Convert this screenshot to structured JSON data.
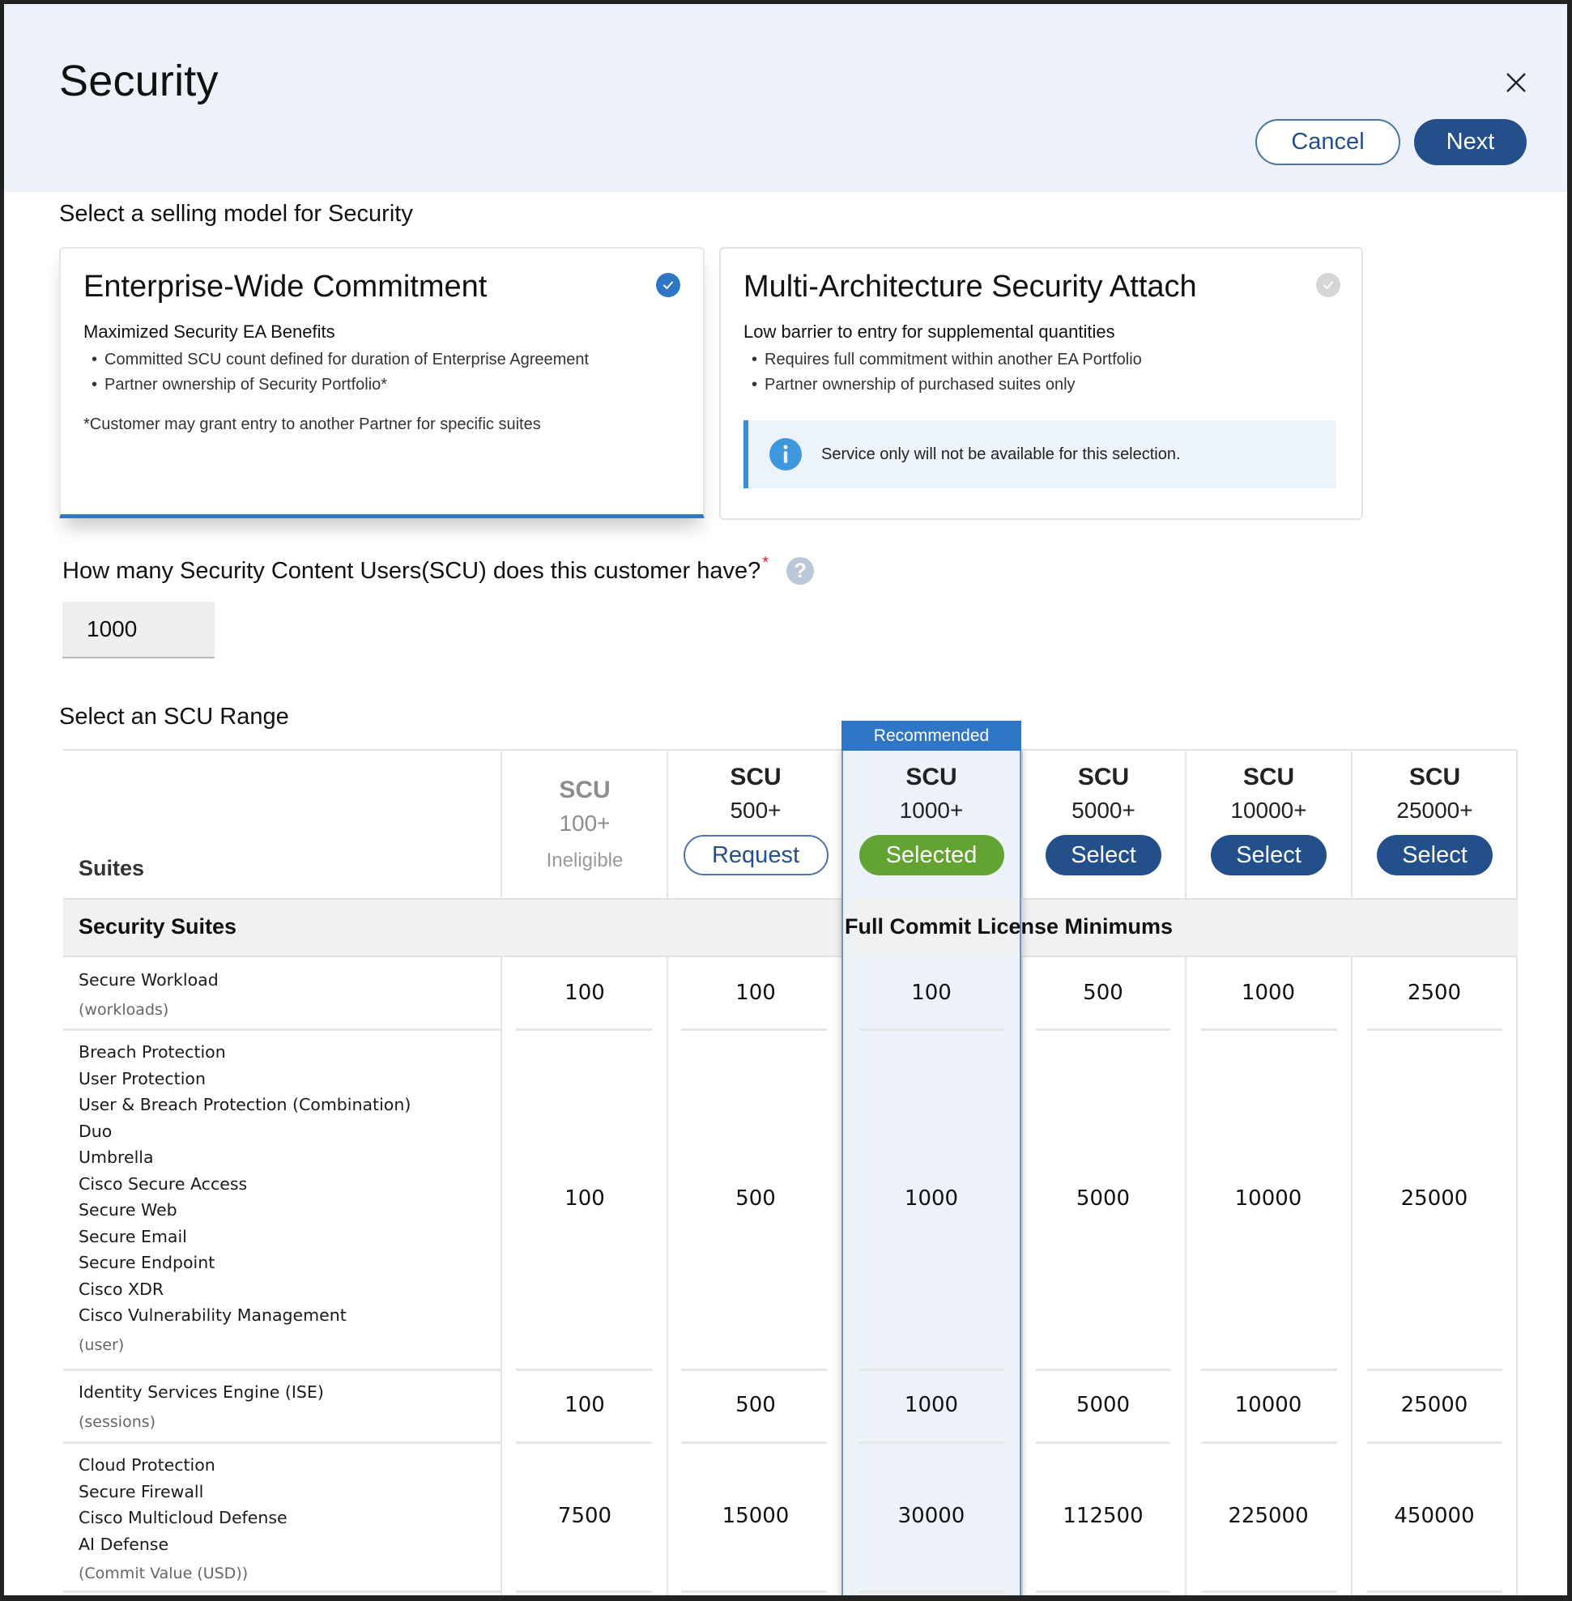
{
  "header": {
    "title": "Security",
    "cancel_label": "Cancel",
    "next_label": "Next"
  },
  "selling_model": {
    "label": "Select a selling model for Security",
    "cards": [
      {
        "title": "Enterprise-Wide Commitment",
        "subtitle": "Maximized Security EA Benefits",
        "bullets": [
          "Committed SCU count defined for duration of Enterprise Agreement",
          "Partner ownership of Security Portfolio*"
        ],
        "note": "*Customer may grant entry to another Partner for specific suites",
        "selected": true
      },
      {
        "title": "Multi-Architecture Security Attach",
        "subtitle": "Low barrier to entry for supplemental quantities",
        "bullets": [
          "Requires full commitment within another EA Portfolio",
          "Partner ownership of purchased suites only"
        ],
        "info": "Service only will not be available for this selection.",
        "selected": false
      }
    ]
  },
  "scu_question": {
    "label": "How many Security Content Users(SCU) does this customer have?",
    "required_mark": "*",
    "help_glyph": "?",
    "value": "1000"
  },
  "scu_range": {
    "label": "Select an SCU Range",
    "recommended_label": "Recommended",
    "suites_header": "Suites",
    "columns": [
      {
        "title": "SCU",
        "range": "100+",
        "status": "Ineligible"
      },
      {
        "title": "SCU",
        "range": "500+",
        "action": "Request"
      },
      {
        "title": "SCU",
        "range": "1000+",
        "action": "Selected"
      },
      {
        "title": "SCU",
        "range": "5000+",
        "action": "Select"
      },
      {
        "title": "SCU",
        "range": "10000+",
        "action": "Select"
      },
      {
        "title": "SCU",
        "range": "25000+",
        "action": "Select"
      }
    ],
    "band_left": "Security Suites",
    "band_center": "Full Commit License Minimums",
    "rows": [
      {
        "suites": [
          "Secure Workload"
        ],
        "unit": "(workloads)",
        "values": [
          "100",
          "100",
          "100",
          "500",
          "1000",
          "2500"
        ]
      },
      {
        "suites": [
          "Breach Protection",
          "User Protection",
          "User & Breach Protection (Combination)",
          "Duo",
          "Umbrella",
          "Cisco Secure Access",
          "Secure Web",
          "Secure Email",
          "Secure Endpoint",
          "Cisco XDR",
          "Cisco Vulnerability Management"
        ],
        "unit": "(user)",
        "values": [
          "100",
          "500",
          "1000",
          "5000",
          "10000",
          "25000"
        ]
      },
      {
        "suites": [
          "Identity Services Engine (ISE)"
        ],
        "unit": "(sessions)",
        "values": [
          "100",
          "500",
          "1000",
          "5000",
          "10000",
          "25000"
        ]
      },
      {
        "suites": [
          "Cloud Protection",
          "Secure Firewall",
          "Cisco Multicloud Defense",
          "AI Defense"
        ],
        "unit": "(Commit Value (USD))",
        "values": [
          "7500",
          "15000",
          "30000",
          "112500",
          "225000",
          "450000"
        ]
      }
    ]
  },
  "colors": {
    "accent_blue": "#2f76c6",
    "primary_button": "#23508b",
    "selected_green": "#63a333",
    "header_bg": "#edf2fa"
  }
}
